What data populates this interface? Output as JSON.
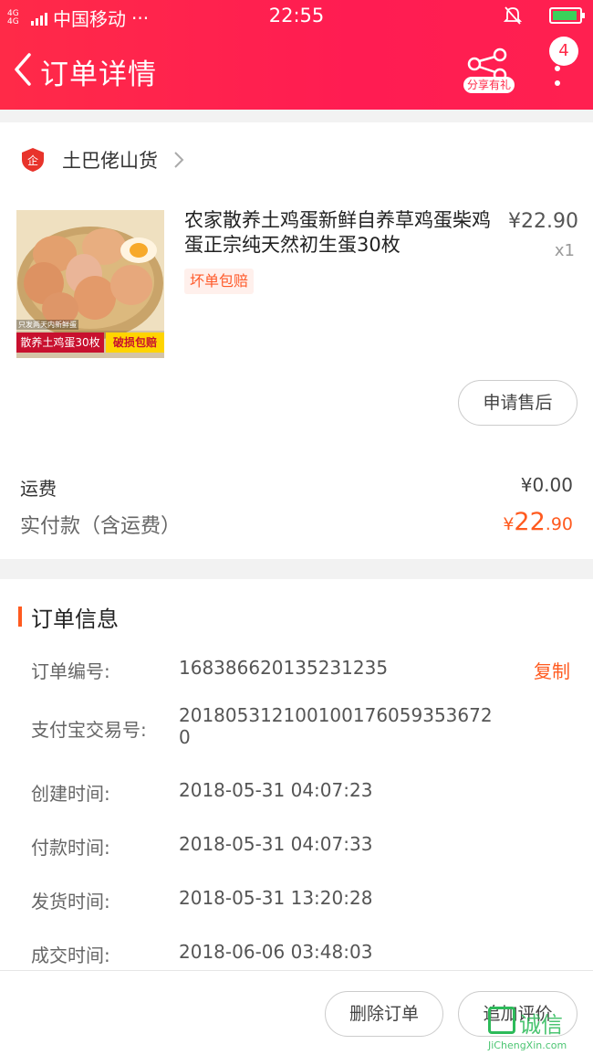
{
  "status_bar": {
    "network": "4G 4G",
    "carrier": "中国移动",
    "dots": "···",
    "time": "22:55"
  },
  "nav": {
    "title": "订单详情",
    "share_label": "分享有礼",
    "badge_count": "4"
  },
  "shop": {
    "name": "土巴佬山货"
  },
  "product": {
    "title": "农家散养土鸡蛋新鲜自养草鸡蛋柴鸡蛋正宗纯天然初生蛋30枚",
    "price": "¥22.90",
    "quantity": "x1",
    "tag": "坏单包赔",
    "image_caption_top": "只发两天内新鲜蛋",
    "image_caption_left": "散养土鸡蛋30枚",
    "image_caption_right": "破损包赔",
    "after_sale_label": "申请售后"
  },
  "fees": {
    "shipping_label": "运费",
    "shipping_value": "¥0.00",
    "paid_label": "实付款（含运费）",
    "paid_currency": "¥",
    "paid_int": "22",
    "paid_dec": ".90"
  },
  "order_info": {
    "section_title": "订单信息",
    "copy_label": "复制",
    "rows": [
      {
        "label": "订单编号:",
        "value": "168386620135231235"
      },
      {
        "label": "支付宝交易号:",
        "value": "2018053121001001760593536720"
      },
      {
        "label": "创建时间:",
        "value": "2018-05-31 04:07:23"
      },
      {
        "label": "付款时间:",
        "value": "2018-05-31 04:07:33"
      },
      {
        "label": "发货时间:",
        "value": "2018-05-31 13:20:28"
      },
      {
        "label": "成交时间:",
        "value": "2018-06-06 03:48:03"
      }
    ]
  },
  "actions": {
    "delete_label": "删除订单",
    "review_label": "追加评价"
  },
  "watermark": {
    "cn": "诚信",
    "en": "JiChengXin.com"
  },
  "colors": {
    "header": "#ff2a48",
    "accent": "#ff5a1f",
    "battery": "#3ad15a",
    "watermark": "#2dbb5a"
  }
}
